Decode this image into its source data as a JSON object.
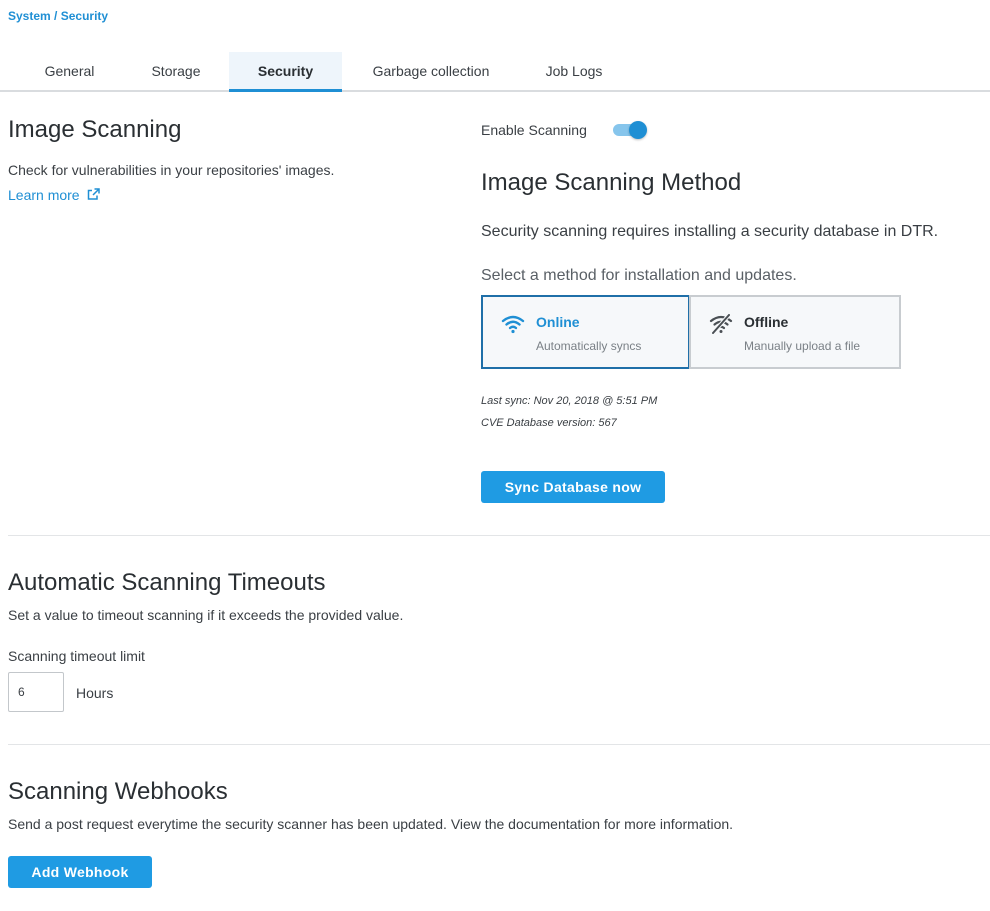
{
  "breadcrumb": {
    "parent": "System",
    "separator": " / ",
    "current": "Security"
  },
  "tabs": [
    {
      "label": "General"
    },
    {
      "label": "Storage"
    },
    {
      "label": "Security"
    },
    {
      "label": "Garbage collection"
    },
    {
      "label": "Job Logs"
    }
  ],
  "image_scanning": {
    "title": "Image Scanning",
    "description": "Check for vulnerabilities in your repositories' images.",
    "learn_more": "Learn more",
    "enable_label": "Enable Scanning",
    "enabled": true
  },
  "method": {
    "title": "Image Scanning Method",
    "requirement": "Security scanning requires installing a security database in DTR.",
    "select_prompt": "Select a method for installation and updates.",
    "options": [
      {
        "title": "Online",
        "subtitle": "Automatically syncs",
        "icon": "wifi-icon",
        "selected": true
      },
      {
        "title": "Offline",
        "subtitle": "Manually upload a file",
        "icon": "wifi-off-icon",
        "selected": false
      }
    ],
    "last_sync": "Last sync: Nov 20, 2018 @ 5:51 PM",
    "cve_version": "CVE Database version: 567",
    "sync_button": "Sync Database now"
  },
  "timeouts": {
    "title": "Automatic Scanning Timeouts",
    "description": "Set a value to timeout scanning if it exceeds the provided value.",
    "field_label": "Scanning timeout limit",
    "value": "6",
    "unit": "Hours"
  },
  "webhooks": {
    "title": "Scanning Webhooks",
    "description": "Send a post request everytime the security scanner has been updated. View the documentation for more information.",
    "add_button": "Add Webhook"
  },
  "colors": {
    "accent": "#1f8fd4",
    "button": "#1f9be3",
    "selected_border": "#1f6fa8"
  }
}
